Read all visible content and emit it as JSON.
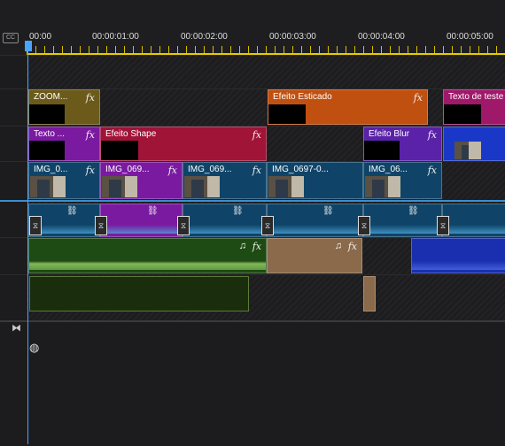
{
  "ruler": {
    "cc_label": "CC",
    "times": [
      "00:00",
      "00:00:01:00",
      "00:00:02:00",
      "00:00:03:00",
      "00:00:04:00",
      "00:00:05:00"
    ]
  },
  "tracks": {
    "effects": [
      {
        "label": "ZOOM...",
        "color": "#6b5a1a"
      },
      {
        "label": "Efeito Esticado",
        "color": "#c05010"
      },
      {
        "label": "Texto de teste",
        "color": "#a0186a"
      }
    ],
    "effects2": [
      {
        "label": "Texto ...",
        "color": "#7a1aa0"
      },
      {
        "label": "Efeito Shape",
        "color": "#a01438"
      },
      {
        "label": "Efeito Blur",
        "color": "#5a22a8"
      }
    ],
    "video": [
      {
        "label": "IMG_0..."
      },
      {
        "label": "IMG_069..."
      },
      {
        "label": "IMG_069..."
      },
      {
        "label": "IMG_0697-0..."
      },
      {
        "label": "IMG_06..."
      }
    ]
  },
  "icons": {
    "fx": "fx",
    "music": "♫",
    "transition": "⧖",
    "link": "⛓"
  }
}
